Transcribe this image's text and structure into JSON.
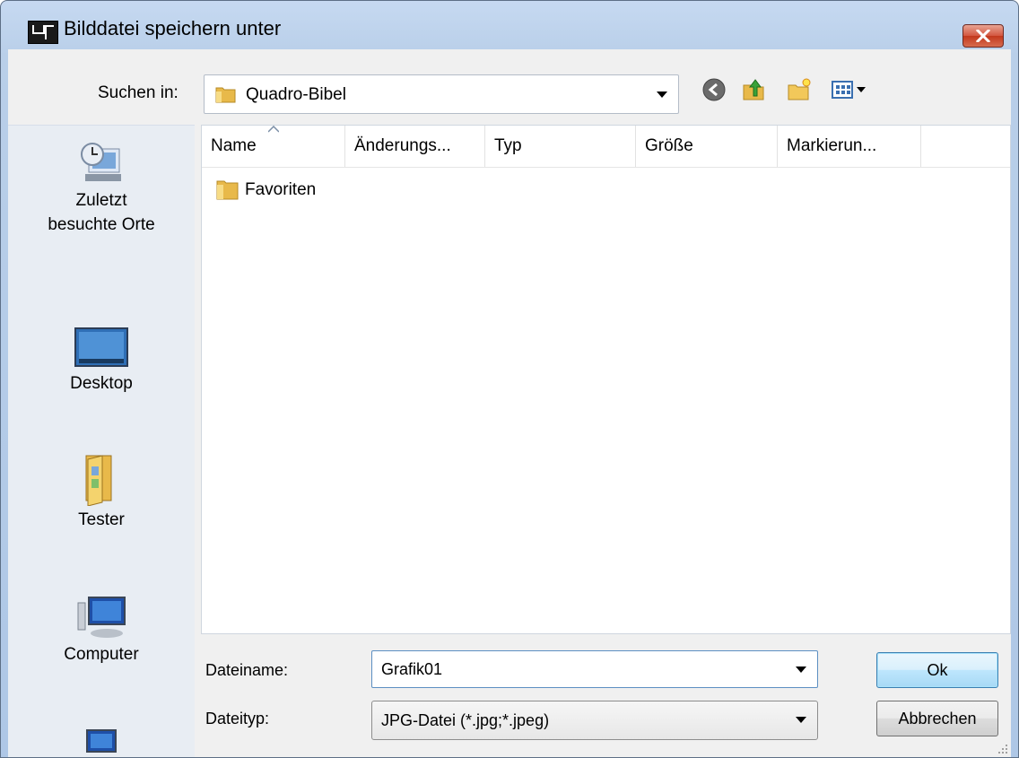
{
  "window": {
    "title": "Bilddatei speichern unter"
  },
  "look_in": {
    "label": "Suchen in:",
    "value": "Quadro-Bibel"
  },
  "toolbar": {
    "icons": [
      "back-icon",
      "up-folder-icon",
      "new-folder-icon",
      "view-menu-icon"
    ]
  },
  "places": [
    {
      "label_line1": "Zuletzt",
      "label_line2": "besuchte Orte",
      "icon": "recent-places-icon"
    },
    {
      "label_line1": "Desktop",
      "label_line2": "",
      "icon": "desktop-icon"
    },
    {
      "label_line1": "Tester",
      "label_line2": "",
      "icon": "user-folder-icon"
    },
    {
      "label_line1": "Computer",
      "label_line2": "",
      "icon": "computer-icon"
    },
    {
      "label_line1": "",
      "label_line2": "",
      "icon": "network-icon"
    }
  ],
  "file_list": {
    "columns": [
      "Name",
      "Änderungs...",
      "Typ",
      "Größe",
      "Markierun..."
    ],
    "sort_column": "Name",
    "items": [
      {
        "name": "Favoriten",
        "icon": "folder-icon"
      }
    ]
  },
  "filename": {
    "label": "Dateiname:",
    "value": "Grafik01"
  },
  "filetype": {
    "label": "Dateityp:",
    "value": "JPG-Datei (*.jpg;*.jpeg)"
  },
  "buttons": {
    "ok": "Ok",
    "cancel": "Abbrechen"
  },
  "colors": {
    "title_bar": "#c6d9f1",
    "close_button": "#c2381d",
    "default_button_border": "#3c7fb1"
  }
}
